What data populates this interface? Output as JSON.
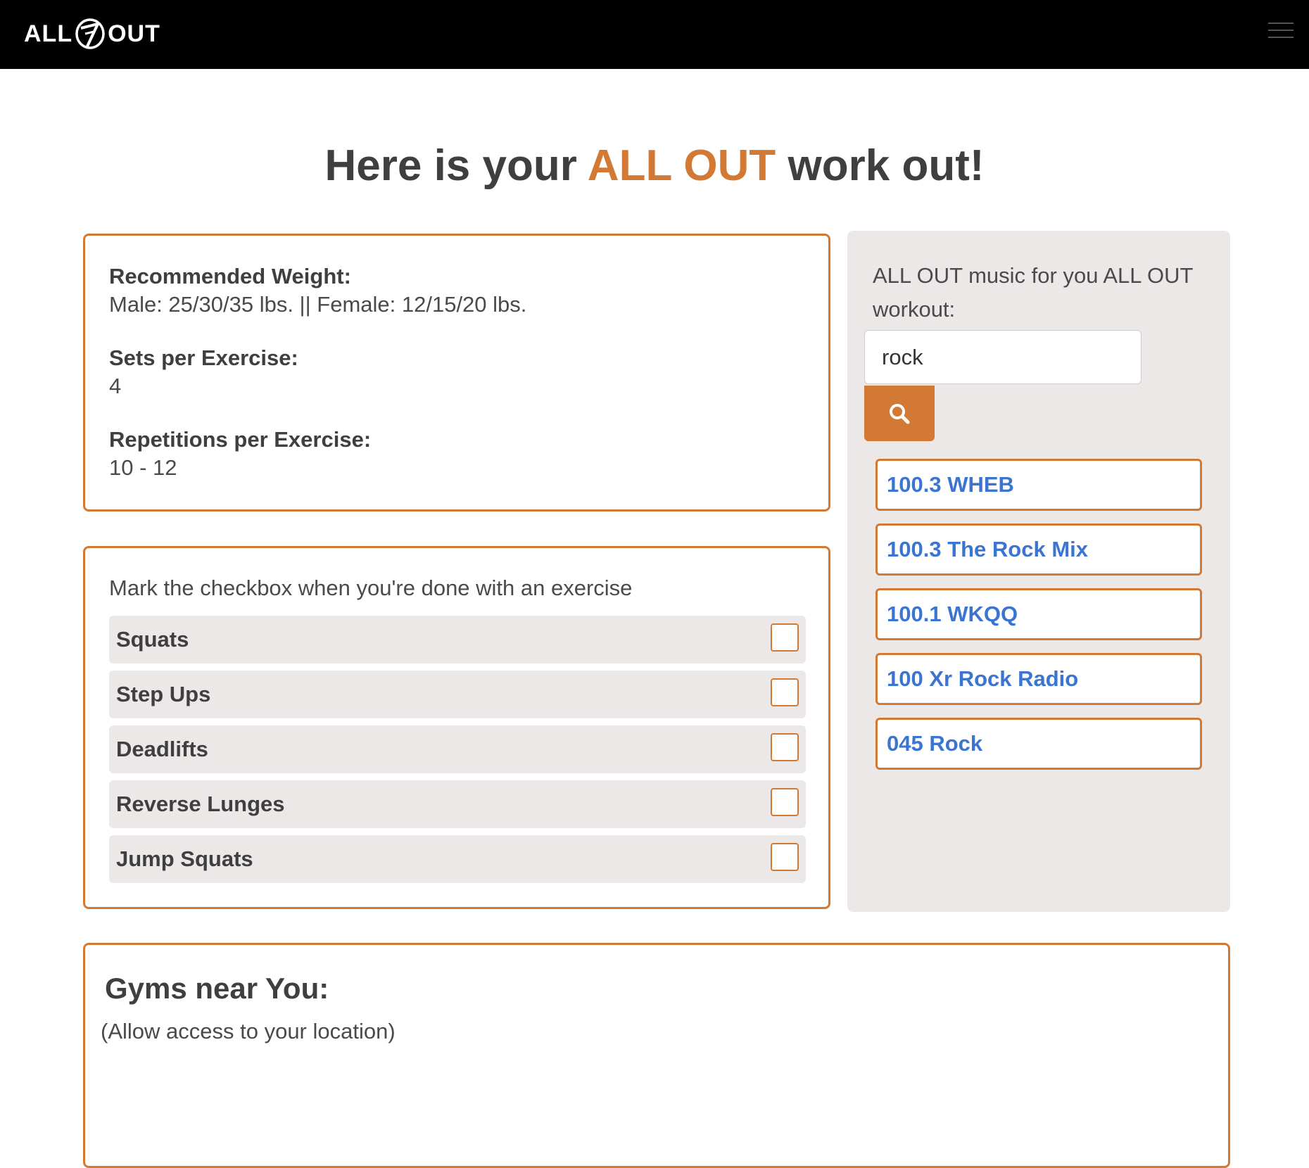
{
  "navbar": {
    "logo_left": "ALL",
    "logo_right": "OUT"
  },
  "title": {
    "prefix": "Here is your ",
    "accent": "ALL OUT",
    "suffix": " work out!"
  },
  "info": {
    "weight_label": "Recommended Weight:",
    "weight_value": "Male: 25/30/35 lbs. || Female: 12/15/20 lbs.",
    "sets_label": "Sets per Exercise:",
    "sets_value": "4",
    "reps_label": "Repetitions per Exercise:",
    "reps_value": "10 - 12"
  },
  "checklist": {
    "hint": "Mark the checkbox when you're done with an exercise",
    "exercises": [
      {
        "name": "Squats",
        "done": false
      },
      {
        "name": "Step Ups",
        "done": false
      },
      {
        "name": "Deadlifts",
        "done": false
      },
      {
        "name": "Reverse Lunges",
        "done": false
      },
      {
        "name": "Jump Squats",
        "done": false
      }
    ]
  },
  "music": {
    "heading": "ALL OUT music for you ALL OUT workout:",
    "search_value": "rock",
    "search_icon": "search-icon",
    "stations": [
      "100.3 WHEB",
      "100.3 The Rock Mix",
      "100.1 WKQQ",
      "100 Xr Rock Radio",
      "045 Rock"
    ]
  },
  "gyms": {
    "title": "Gyms near You:",
    "note": "(Allow access to your location)"
  },
  "colors": {
    "accent": "#d27a35",
    "navbar": "#000000",
    "panel": "#ede8e8",
    "link": "#3b74d1"
  }
}
